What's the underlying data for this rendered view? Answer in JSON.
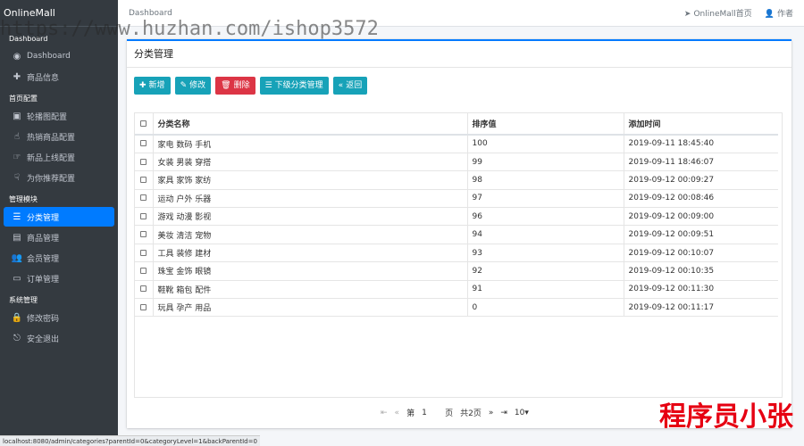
{
  "sidebar": {
    "brand": "OnlineMall",
    "sections": [
      {
        "title": "Dashboard",
        "items": [
          {
            "icon": "dashboard-icon",
            "glyph": "◉",
            "label": "Dashboard"
          },
          {
            "icon": "plus-icon",
            "glyph": "✚",
            "label": "商品信息"
          }
        ]
      },
      {
        "title": "首页配置",
        "items": [
          {
            "icon": "image-icon",
            "glyph": "▣",
            "label": "轮播图配置"
          },
          {
            "icon": "hand-icon",
            "glyph": "☝",
            "label": "热销商品配置"
          },
          {
            "icon": "hand-icon",
            "glyph": "☞",
            "label": "新品上线配置"
          },
          {
            "icon": "hand-icon",
            "glyph": "☟",
            "label": "为你推荐配置"
          }
        ]
      },
      {
        "title": "管理模块",
        "items": [
          {
            "icon": "list-icon",
            "glyph": "☰",
            "label": "分类管理",
            "active": true
          },
          {
            "icon": "grid-icon",
            "glyph": "▤",
            "label": "商品管理"
          },
          {
            "icon": "users-icon",
            "glyph": "👥",
            "label": "会员管理"
          },
          {
            "icon": "money-icon",
            "glyph": "▭",
            "label": "订单管理"
          }
        ]
      },
      {
        "title": "系统管理",
        "items": [
          {
            "icon": "lock-icon",
            "glyph": "🔒",
            "label": "修改密码"
          },
          {
            "icon": "logout-icon",
            "glyph": "⎋",
            "label": "安全退出"
          }
        ]
      }
    ]
  },
  "topbar": {
    "breadcrumb": "Dashboard",
    "home_link": "OnlineMall首页",
    "author_link": "作者"
  },
  "watermark": "https://www.huzhan.com/ishop3572",
  "card": {
    "title": "分类管理",
    "buttons": [
      {
        "name": "add-button",
        "glyph": "✚",
        "label": "新增",
        "style": "info"
      },
      {
        "name": "edit-button",
        "glyph": "✎",
        "label": "修改",
        "style": "info"
      },
      {
        "name": "delete-button",
        "glyph": "🗑",
        "label": "删除",
        "style": "danger"
      },
      {
        "name": "subcategory-button",
        "glyph": "☰",
        "label": "下级分类管理",
        "style": "info"
      },
      {
        "name": "back-button",
        "glyph": "«",
        "label": "返回",
        "style": "info"
      }
    ]
  },
  "table": {
    "columns": [
      "分类名称",
      "排序值",
      "添加时间"
    ],
    "rows": [
      [
        "家电 数码 手机",
        "100",
        "2019-09-11 18:45:40"
      ],
      [
        "女装 男装 穿搭",
        "99",
        "2019-09-11 18:46:07"
      ],
      [
        "家具 家饰 家纺",
        "98",
        "2019-09-12 00:09:27"
      ],
      [
        "运动 户外 乐器",
        "97",
        "2019-09-12 00:08:46"
      ],
      [
        "游戏 动漫 影视",
        "96",
        "2019-09-12 00:09:00"
      ],
      [
        "美妆 清洁 宠物",
        "94",
        "2019-09-12 00:09:51"
      ],
      [
        "工具 装修 建材",
        "93",
        "2019-09-12 00:10:07"
      ],
      [
        "珠宝 金饰 眼镜",
        "92",
        "2019-09-12 00:10:35"
      ],
      [
        "鞋靴 箱包 配件",
        "91",
        "2019-09-12 00:11:30"
      ],
      [
        "玩具 孕产 用品",
        "0",
        "2019-09-12 00:11:17"
      ]
    ]
  },
  "pager": {
    "first": "⇤",
    "prev": "«",
    "page_prefix": "第",
    "page_value": "1",
    "page_suffix": "页",
    "total": "共2页",
    "next": "»",
    "last": "⇥",
    "page_size": "10▾"
  },
  "status_url": "localhost:8080/admin/categories?parentId=0&categoryLevel=1&backParentId=0",
  "author_watermark": "程序员小张",
  "colors": {
    "sidebar": "#343a40",
    "accent": "#007bff",
    "info": "#17a2b8",
    "danger": "#dc3545"
  }
}
